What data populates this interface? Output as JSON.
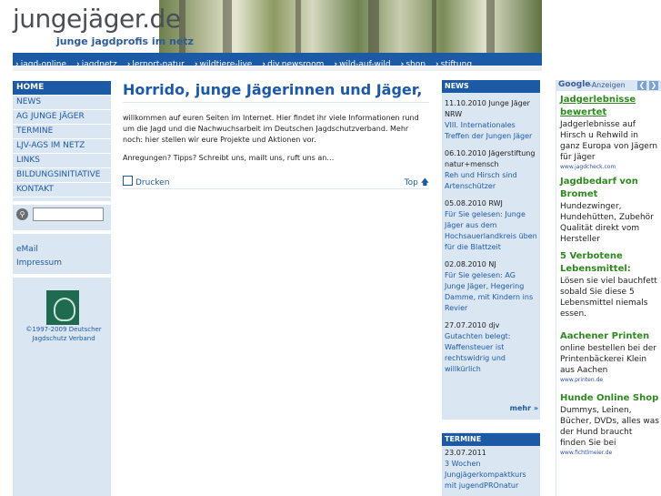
{
  "header": {
    "title": "jungejäger.de",
    "subtitle": "junge jagdprofis im netz"
  },
  "topnav": [
    "jagd-online",
    "jagdnetz",
    "lernort-natur",
    "wildtiere-live",
    "djv.newsroom",
    "wild-auf-wild",
    "shop",
    "stiftung"
  ],
  "leftnav": {
    "items": [
      "HOME",
      "NEWS",
      "AG JUNGE JÄGER",
      "TERMINE",
      "LJV-AGS IM NETZ",
      "LINKS",
      "BILDUNGSINITIATIVE",
      "KONTAKT"
    ],
    "search_placeholder": "",
    "email": "eMail",
    "impressum": "Impressum",
    "copyright_1": "©1997-2009 Deutscher",
    "copyright_2": "Jagdschutz Verband"
  },
  "main": {
    "heading": "Horrido, junge Jägerinnen und Jäger,",
    "p1": "willkommen auf euren Seiten im Internet. Hier findet ihr viele Informationen rund um die Jagd und die Nachwuchsarbeit im Deutschen Jagdschutzverband. Mehr noch: hier stellen wir eure Projekte und Aktionen vor.",
    "p2": "Anregungen? Tipps? Schreibt uns, mailt uns, ruft uns an…",
    "print": "Drucken",
    "top": "Top"
  },
  "news": {
    "header": "NEWS",
    "items": [
      {
        "date": "11.10.2010 Junge Jäger NRW",
        "title": "VIII. Internationales Treffen der Jungen Jäger"
      },
      {
        "date": "06.10.2010 Jägerstiftung natur+mensch",
        "title": "Reh und Hirsch sind Artenschützer"
      },
      {
        "date": "05.08.2010 RWJ",
        "title": "Für Sie gelesen: Junge Jäger aus dem Hochsauerlandkreis üben für die Blattzeit"
      },
      {
        "date": "02.08.2010 NJ",
        "title": "Für Sie gelesen: AG Junge Jäger, Hegering Damme, mit Kindern ins Revier"
      },
      {
        "date": "27.07.2010 djv",
        "title": "Gutachten belegt: Waffensteuer ist rechtswidrig und willkürlich"
      }
    ],
    "more": "mehr »",
    "termine_header": "TERMINE",
    "termine": [
      {
        "date": "23.07.2011",
        "title": "3 Wochen Jungjägerkompaktkurs mit jugendPROnatur"
      }
    ]
  },
  "ads": {
    "brand": "Google",
    "label": "-Anzeigen",
    "items": [
      {
        "title": "Jadgerlebnisse bewertet",
        "body": "Jadgerlebnisse auf Hirsch u Rehwild in ganz Europa von Jägern für Jäger",
        "url": "www.jagdcheck.com"
      },
      {
        "title": "Jagdbedarf von Bromet",
        "body": "Hundezwinger, Hundehütten, Zubehör Qualität direkt vom Hersteller",
        "url": ""
      },
      {
        "title": "5 Verbotene Lebensmittel:",
        "body": "Lösen sie viel bauchfett sobald Sie diese 5 Lebensmittel niemals essen.",
        "url": ""
      },
      {
        "title": "Aachener Printen",
        "body": "online bestellen bei der Printenbäckerei Klein aus Aachen",
        "url": "www.printen.de"
      },
      {
        "title": "Hunde Online Shop",
        "body": "Dummys, Leinen, Bücher, DVDs, alles was der Hund braucht finden Sie bei",
        "url": "www.fichtlmeier.de"
      }
    ]
  }
}
